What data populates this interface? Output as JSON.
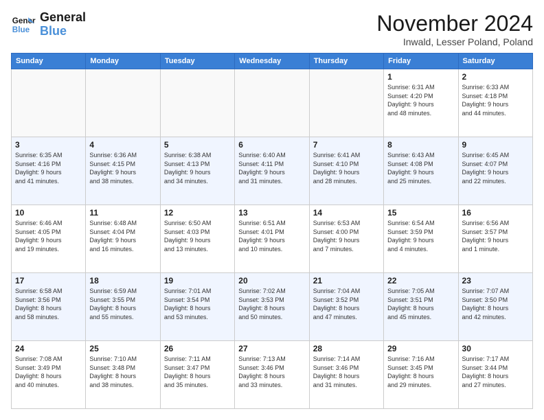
{
  "logo": {
    "line1": "General",
    "line2": "Blue"
  },
  "title": "November 2024",
  "location": "Inwald, Lesser Poland, Poland",
  "days_of_week": [
    "Sunday",
    "Monday",
    "Tuesday",
    "Wednesday",
    "Thursday",
    "Friday",
    "Saturday"
  ],
  "weeks": [
    [
      {
        "day": "",
        "info": ""
      },
      {
        "day": "",
        "info": ""
      },
      {
        "day": "",
        "info": ""
      },
      {
        "day": "",
        "info": ""
      },
      {
        "day": "",
        "info": ""
      },
      {
        "day": "1",
        "info": "Sunrise: 6:31 AM\nSunset: 4:20 PM\nDaylight: 9 hours\nand 48 minutes."
      },
      {
        "day": "2",
        "info": "Sunrise: 6:33 AM\nSunset: 4:18 PM\nDaylight: 9 hours\nand 44 minutes."
      }
    ],
    [
      {
        "day": "3",
        "info": "Sunrise: 6:35 AM\nSunset: 4:16 PM\nDaylight: 9 hours\nand 41 minutes."
      },
      {
        "day": "4",
        "info": "Sunrise: 6:36 AM\nSunset: 4:15 PM\nDaylight: 9 hours\nand 38 minutes."
      },
      {
        "day": "5",
        "info": "Sunrise: 6:38 AM\nSunset: 4:13 PM\nDaylight: 9 hours\nand 34 minutes."
      },
      {
        "day": "6",
        "info": "Sunrise: 6:40 AM\nSunset: 4:11 PM\nDaylight: 9 hours\nand 31 minutes."
      },
      {
        "day": "7",
        "info": "Sunrise: 6:41 AM\nSunset: 4:10 PM\nDaylight: 9 hours\nand 28 minutes."
      },
      {
        "day": "8",
        "info": "Sunrise: 6:43 AM\nSunset: 4:08 PM\nDaylight: 9 hours\nand 25 minutes."
      },
      {
        "day": "9",
        "info": "Sunrise: 6:45 AM\nSunset: 4:07 PM\nDaylight: 9 hours\nand 22 minutes."
      }
    ],
    [
      {
        "day": "10",
        "info": "Sunrise: 6:46 AM\nSunset: 4:05 PM\nDaylight: 9 hours\nand 19 minutes."
      },
      {
        "day": "11",
        "info": "Sunrise: 6:48 AM\nSunset: 4:04 PM\nDaylight: 9 hours\nand 16 minutes."
      },
      {
        "day": "12",
        "info": "Sunrise: 6:50 AM\nSunset: 4:03 PM\nDaylight: 9 hours\nand 13 minutes."
      },
      {
        "day": "13",
        "info": "Sunrise: 6:51 AM\nSunset: 4:01 PM\nDaylight: 9 hours\nand 10 minutes."
      },
      {
        "day": "14",
        "info": "Sunrise: 6:53 AM\nSunset: 4:00 PM\nDaylight: 9 hours\nand 7 minutes."
      },
      {
        "day": "15",
        "info": "Sunrise: 6:54 AM\nSunset: 3:59 PM\nDaylight: 9 hours\nand 4 minutes."
      },
      {
        "day": "16",
        "info": "Sunrise: 6:56 AM\nSunset: 3:57 PM\nDaylight: 9 hours\nand 1 minute."
      }
    ],
    [
      {
        "day": "17",
        "info": "Sunrise: 6:58 AM\nSunset: 3:56 PM\nDaylight: 8 hours\nand 58 minutes."
      },
      {
        "day": "18",
        "info": "Sunrise: 6:59 AM\nSunset: 3:55 PM\nDaylight: 8 hours\nand 55 minutes."
      },
      {
        "day": "19",
        "info": "Sunrise: 7:01 AM\nSunset: 3:54 PM\nDaylight: 8 hours\nand 53 minutes."
      },
      {
        "day": "20",
        "info": "Sunrise: 7:02 AM\nSunset: 3:53 PM\nDaylight: 8 hours\nand 50 minutes."
      },
      {
        "day": "21",
        "info": "Sunrise: 7:04 AM\nSunset: 3:52 PM\nDaylight: 8 hours\nand 47 minutes."
      },
      {
        "day": "22",
        "info": "Sunrise: 7:05 AM\nSunset: 3:51 PM\nDaylight: 8 hours\nand 45 minutes."
      },
      {
        "day": "23",
        "info": "Sunrise: 7:07 AM\nSunset: 3:50 PM\nDaylight: 8 hours\nand 42 minutes."
      }
    ],
    [
      {
        "day": "24",
        "info": "Sunrise: 7:08 AM\nSunset: 3:49 PM\nDaylight: 8 hours\nand 40 minutes."
      },
      {
        "day": "25",
        "info": "Sunrise: 7:10 AM\nSunset: 3:48 PM\nDaylight: 8 hours\nand 38 minutes."
      },
      {
        "day": "26",
        "info": "Sunrise: 7:11 AM\nSunset: 3:47 PM\nDaylight: 8 hours\nand 35 minutes."
      },
      {
        "day": "27",
        "info": "Sunrise: 7:13 AM\nSunset: 3:46 PM\nDaylight: 8 hours\nand 33 minutes."
      },
      {
        "day": "28",
        "info": "Sunrise: 7:14 AM\nSunset: 3:46 PM\nDaylight: 8 hours\nand 31 minutes."
      },
      {
        "day": "29",
        "info": "Sunrise: 7:16 AM\nSunset: 3:45 PM\nDaylight: 8 hours\nand 29 minutes."
      },
      {
        "day": "30",
        "info": "Sunrise: 7:17 AM\nSunset: 3:44 PM\nDaylight: 8 hours\nand 27 minutes."
      }
    ]
  ]
}
